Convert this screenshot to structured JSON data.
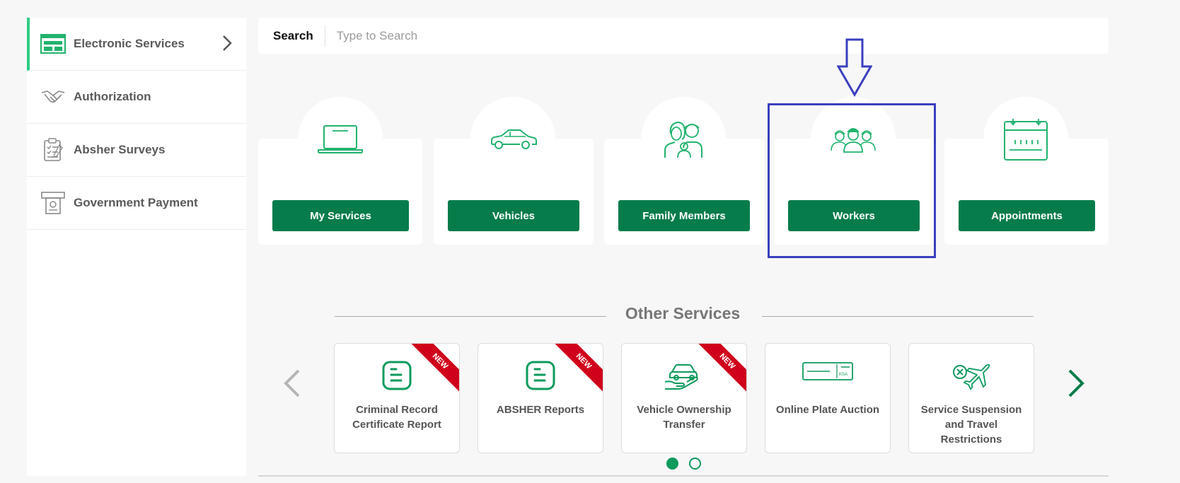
{
  "sidebar": {
    "items": [
      {
        "label": "Electronic Services",
        "icon": "electronic-services-icon",
        "active": true
      },
      {
        "label": "Authorization",
        "icon": "handshake-icon"
      },
      {
        "label": "Absher Surveys",
        "icon": "clipboard-icon"
      },
      {
        "label": "Government Payment",
        "icon": "atm-payment-icon"
      }
    ]
  },
  "search": {
    "label": "Search",
    "placeholder": "Type to Search"
  },
  "services": [
    {
      "label": "My Services",
      "icon": "laptop-icon"
    },
    {
      "label": "Vehicles",
      "icon": "car-icon"
    },
    {
      "label": "Family Members",
      "icon": "family-icon"
    },
    {
      "label": "Workers",
      "icon": "workers-icon"
    },
    {
      "label": "Appointments",
      "icon": "calendar-icon"
    }
  ],
  "other_services": {
    "title": "Other Services",
    "badge": "NEW",
    "items": [
      {
        "label": "Criminal Record Certificate Report",
        "icon": "document-icon",
        "new": true
      },
      {
        "label": "ABSHER Reports",
        "icon": "document-icon",
        "new": true
      },
      {
        "label": "Vehicle Ownership Transfer",
        "icon": "car-hand-icon",
        "new": true
      },
      {
        "label": "Online Plate Auction",
        "icon": "license-plate-icon",
        "new": false
      },
      {
        "label": "Service Suspension and Travel Restrictions",
        "icon": "plane-suspension-icon",
        "new": false
      }
    ],
    "plate_text": "KSA"
  },
  "colors": {
    "brand_green": "#077c4b",
    "accent_green": "#2ecc84",
    "highlight": "#3a3fbf",
    "ribbon_red": "#d0021b"
  }
}
